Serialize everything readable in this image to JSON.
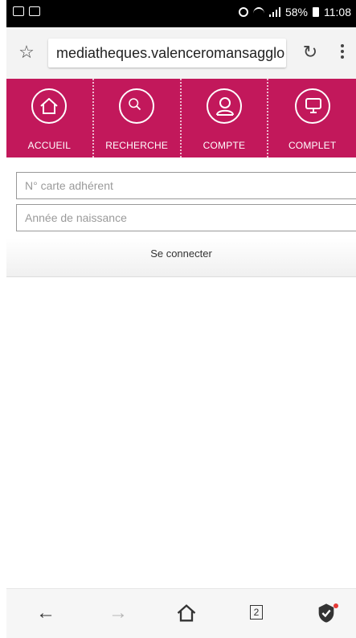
{
  "status_bar": {
    "battery": "58%",
    "time": "11:08"
  },
  "browser": {
    "url": "mediatheques.valenceromansagglo"
  },
  "nav": [
    {
      "label": "ACCUEIL",
      "icon": "home-icon"
    },
    {
      "label": "RECHERCHE",
      "icon": "search-icon"
    },
    {
      "label": "COMPTE",
      "icon": "user-icon"
    },
    {
      "label": "COMPLET",
      "icon": "monitor-icon"
    }
  ],
  "form": {
    "card_placeholder": "N° carte adhérent",
    "birth_placeholder": "Année de naissance",
    "submit_label": "Se connecter"
  },
  "bottom_bar": {
    "tab_count": "2"
  },
  "colors": {
    "nav_bg": "#c2185b"
  }
}
